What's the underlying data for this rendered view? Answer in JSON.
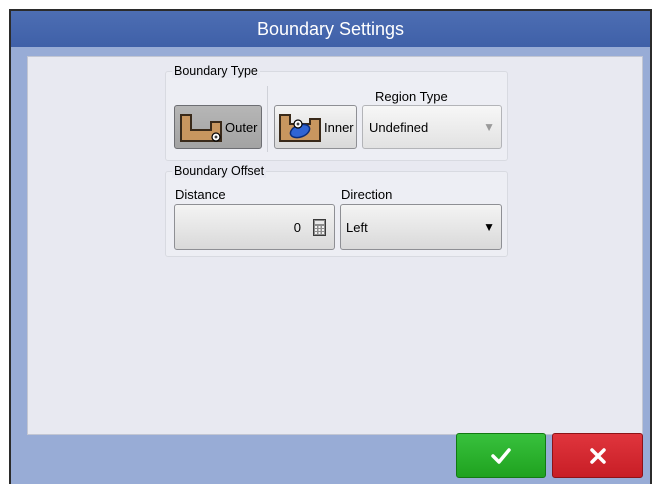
{
  "title": "Boundary Settings",
  "boundary_type": {
    "legend": "Boundary Type",
    "outer_label": "Outer",
    "inner_label": "Inner",
    "selected": "Outer",
    "region_type_label": "Region Type",
    "region_type_value": "Undefined"
  },
  "boundary_offset": {
    "legend": "Boundary Offset",
    "distance_label": "Distance",
    "distance_value": "0",
    "direction_label": "Direction",
    "direction_value": "Left"
  },
  "colors": {
    "title_bar": "#4566ad",
    "ok": "#2bb32e",
    "cancel": "#d42a31"
  },
  "icons": {
    "distance_button": "calculator-icon",
    "ok": "checkmark-icon",
    "cancel": "x-icon"
  }
}
